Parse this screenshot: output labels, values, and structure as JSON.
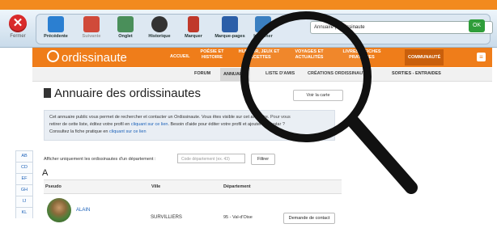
{
  "toolbar": {
    "close_label": "Fermer",
    "buttons": [
      {
        "label": "Précédente",
        "icon": "back-arrow-icon"
      },
      {
        "label": "Suivante",
        "icon": "forward-arrow-icon"
      },
      {
        "label": "Onglet",
        "icon": "tab-icon"
      },
      {
        "label": "Historique",
        "icon": "history-icon"
      },
      {
        "label": "Marquer",
        "icon": "bookmark-icon"
      },
      {
        "label": "Marque-pages",
        "icon": "bookmarks-icon"
      },
      {
        "label": "Imprimer",
        "icon": "printer-icon"
      }
    ],
    "address": "Annuaire | Ordissinaute",
    "ok_label": "OK"
  },
  "site": {
    "logo": "ordissinaute",
    "nav": [
      {
        "label": "ACCUEIL"
      },
      {
        "label": "POÉSIE ET HISTOIRE"
      },
      {
        "label": "HUMOUR, JEUX ET RECETTES"
      },
      {
        "label": "VOYAGES ET ACTUALITÉS"
      },
      {
        "label": "LIVRES & FICHES PRATIQUES"
      },
      {
        "label": "COMMUNAUTÉ"
      }
    ],
    "subnav": [
      {
        "label": "FORUM"
      },
      {
        "label": "ANNUAIRE"
      },
      {
        "label": "LISTE D'AMIS"
      },
      {
        "label": "CRÉATIONS ORDISSINAUTES"
      },
      {
        "label": "SORTIES - ENTRAIDES"
      }
    ]
  },
  "main": {
    "title": "Annuaire des ordissinautes",
    "map_button": "Voir la carte",
    "info_line1": "Cet annuaire public vous permet de rechercher et contacter un Ordissinaute. Vous êtes visible sur cet annuaire. Pour vous",
    "info_line2a": "retirer de cette liste, éditez votre profil en",
    "info_link1": "cliquant sur ce lien",
    "info_line2b": ". Besoin d'aide pour éditer votre profil et ajouter un avatar ?",
    "info_line3a": "Consultez la fiche pratique en",
    "info_link2": "cliquant sur ce lien",
    "filter_label": "Afficher uniquement les ordissinautes d'un département :",
    "filter_placeholder": "Code département (ex. 43)",
    "filter_button": "Filtrer",
    "section_letter": "A",
    "table": {
      "headers": [
        "Pseudo",
        "Ville",
        "Département"
      ],
      "rows": [
        {
          "pseudo": "ALAIN",
          "ville": "SURVILLIERS",
          "departement": "95 - Val-d'Oise",
          "action": "Demande de contact"
        }
      ]
    },
    "alphabet": [
      "AB",
      "CD",
      "EF",
      "GH",
      "IJ",
      "KL"
    ]
  },
  "colors": {
    "brand_orange": "#ef7d1a",
    "link_blue": "#1c62b9",
    "close_red": "#d92b2b"
  }
}
